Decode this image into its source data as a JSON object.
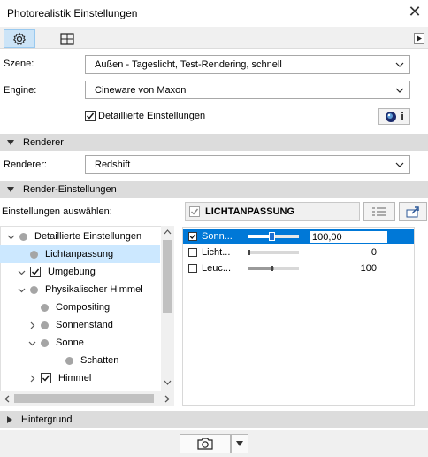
{
  "window": {
    "title": "Photorealistik Einstellungen"
  },
  "tabs": [
    {
      "icon": "gear-icon"
    },
    {
      "icon": "grid-icon"
    }
  ],
  "form": {
    "scene_label": "Szene:",
    "scene_value": "Außen - Tageslicht, Test-Rendering, schnell",
    "engine_label": "Engine:",
    "engine_value": "Cineware von Maxon",
    "detailed_label": "Detaillierte Einstellungen",
    "detailed_checked": true,
    "info_button_text": "i"
  },
  "sections": {
    "renderer": "Renderer",
    "render_settings": "Render-Einstellungen",
    "background": "Hintergrund"
  },
  "renderer": {
    "label": "Renderer:",
    "value": "Redshift"
  },
  "settings": {
    "select_label": "Einstellungen auswählen:",
    "header_label": "LICHTANPASSUNG",
    "header_checked": true
  },
  "tree": [
    {
      "label": "Detaillierte Einstellungen",
      "expander": "down",
      "marker": "dot",
      "level": 0
    },
    {
      "label": "Lichtanpassung",
      "expander": "",
      "marker": "dot",
      "level": 1,
      "selected": true
    },
    {
      "label": "Umgebung",
      "expander": "down",
      "marker": "checkbox",
      "level": 1
    },
    {
      "label": "Physikalischer Himmel",
      "expander": "down",
      "marker": "dot",
      "level": 2
    },
    {
      "label": "Compositing",
      "expander": "",
      "marker": "dot",
      "level": 3
    },
    {
      "label": "Sonnenstand",
      "expander": "right",
      "marker": "dot",
      "level": 3
    },
    {
      "label": "Sonne",
      "expander": "down",
      "marker": "dot",
      "level": 3
    },
    {
      "label": "Schatten",
      "expander": "",
      "marker": "dot",
      "level": 4
    },
    {
      "label": "Himmel",
      "expander": "right",
      "marker": "checkbox",
      "level": 3
    }
  ],
  "properties": [
    {
      "name": "Sonn...",
      "checked": true,
      "value": "100,00",
      "slider_fraction": 0.45,
      "selected": true,
      "editing": true
    },
    {
      "name": "Licht...",
      "checked": false,
      "value": "0",
      "slider_fraction": 0.0,
      "selected": false,
      "editing": false
    },
    {
      "name": "Leuc...",
      "checked": false,
      "value": "100",
      "slider_fraction": 0.5,
      "selected": false,
      "editing": false
    }
  ],
  "colors": {
    "selection_blue": "#0078d7",
    "tree_selection": "#cce8ff",
    "section_bg": "#dcdcdc"
  },
  "footer": {
    "camera_icon": "camera-icon",
    "dropdown_icon": "chevron-down-icon"
  }
}
